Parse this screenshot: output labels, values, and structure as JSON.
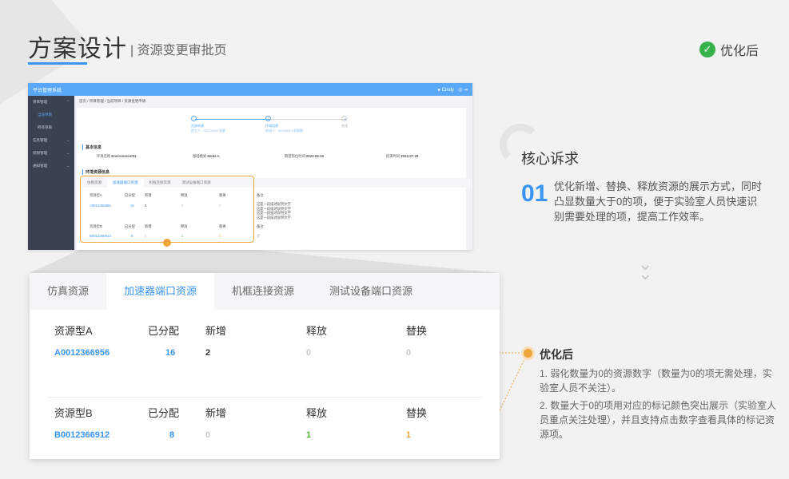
{
  "header": {
    "title": "方案设计",
    "subtitle": "资源变更审批页",
    "badge": "优化后"
  },
  "mini": {
    "app_title": "平台管理系统",
    "user": "Cindy",
    "sidebar": [
      {
        "label": "项目管理"
      },
      {
        "label": "当前项目"
      },
      {
        "label": "所有项目"
      },
      {
        "label": "任务管理"
      },
      {
        "label": "权限管理"
      },
      {
        "label": "通知管理"
      }
    ],
    "breadcrumb": [
      "首页",
      "项目管理",
      "当前项目",
      "资源变更申请"
    ],
    "steps": [
      {
        "label": "资源申请",
        "sub": "提交人：00123456 张晨"
      },
      {
        "label": "环境搭建",
        "sub": "处理人：00325619 李晨晨"
      },
      {
        "label": "完成",
        "sub": ""
      }
    ],
    "basic_title": "基本信息",
    "fields": [
      {
        "k": "环境名称",
        "v": "Environment01"
      },
      {
        "k": "基础模式",
        "v": "Mode A"
      },
      {
        "k": "期望到位时间",
        "v": "2023-06-26"
      },
      {
        "k": "结束时间",
        "v": "2023-07-29"
      }
    ],
    "env_title": "环境资源信息",
    "note_label": "备注",
    "note_lines": [
      "这是一段描述说明文字",
      "这是一段描述说明文字",
      "这是一段描述说明文字",
      "这是一段描述说明文字"
    ],
    "note_empty": "无"
  },
  "panel": {
    "tabs": [
      "仿真资源",
      "加速器端口资源",
      "机框连接资源",
      "测试设备端口资源"
    ],
    "columns_a": [
      "资源型A",
      "已分配",
      "新增",
      "释放",
      "替换"
    ],
    "row_a": {
      "id": "A0012366956",
      "allocated": "16",
      "add": "2",
      "release": "0",
      "replace": "0"
    },
    "columns_b": [
      "资源型B",
      "已分配",
      "新增",
      "释放",
      "替换"
    ],
    "row_b": {
      "id": "B0012366912",
      "allocated": "8",
      "add": "0",
      "release": "1",
      "replace": "1"
    }
  },
  "core": {
    "title": "核心诉求",
    "num": "01",
    "text": "优化新增、替换、释放资源的展示方式，同时凸显数量大于0的项，便于实验室人员快速识别需要处理的项，提高工作效率。"
  },
  "after": {
    "title": "优化后",
    "items": [
      "1. 弱化数量为0的资源数字（数量为0的项无需处理，实验室人员不关注）。",
      "2. 数量大于0的项用对应的标记颜色突出展示（实验室人员重点关注处理），并且支持点击数字查看具体的标记资源项。"
    ]
  },
  "colors": {
    "accent": "#3b95f5",
    "orange": "#f0a53c",
    "green": "#52b33a",
    "sidebar": "#3a4150"
  }
}
